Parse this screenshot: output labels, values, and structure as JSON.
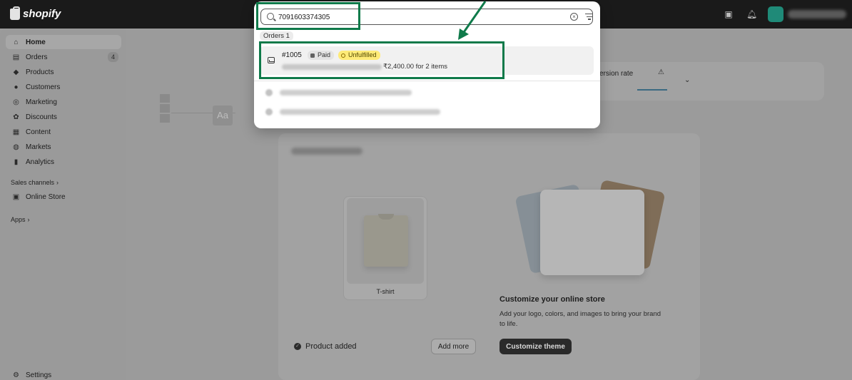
{
  "topbar": {
    "logo_text": "shopify",
    "icons": [
      "store-icon",
      "bell-icon"
    ]
  },
  "sidebar": {
    "items": [
      {
        "label": "Home",
        "icon": "home-icon",
        "active": true
      },
      {
        "label": "Orders",
        "icon": "orders-icon",
        "count": "4"
      },
      {
        "label": "Products",
        "icon": "tag-icon"
      },
      {
        "label": "Customers",
        "icon": "person-icon"
      },
      {
        "label": "Marketing",
        "icon": "target-icon"
      },
      {
        "label": "Discounts",
        "icon": "discount-icon"
      },
      {
        "label": "Content",
        "icon": "content-icon"
      },
      {
        "label": "Markets",
        "icon": "globe-icon"
      },
      {
        "label": "Analytics",
        "icon": "analytics-icon"
      }
    ],
    "sales_channels_label": "Sales channels",
    "online_store_label": "Online Store",
    "apps_label": "Apps",
    "settings_label": "Settings"
  },
  "main": {
    "metrics_label": "ersion rate",
    "product_label": "T-shirt",
    "product_added": "Product added",
    "add_more": "Add more",
    "customize_theme": "Customize theme",
    "theme_title": "Customize your online store",
    "theme_desc": "Add your logo, colors, and images to bring your brand to life.",
    "theme_aa": "Aa"
  },
  "search": {
    "query": "7091603374305",
    "orders_chip": "Orders 1",
    "result": {
      "order_number": "#1005",
      "paid_badge": "Paid",
      "unfulfilled_badge": "Unfulfilled",
      "total": "₹2,400.00 for 2 items"
    }
  },
  "colors": {
    "highlight": "#0f7a4a",
    "unfulfilled_badge_bg": "#ffeb78",
    "topbar_bg": "#1a1a1a"
  }
}
